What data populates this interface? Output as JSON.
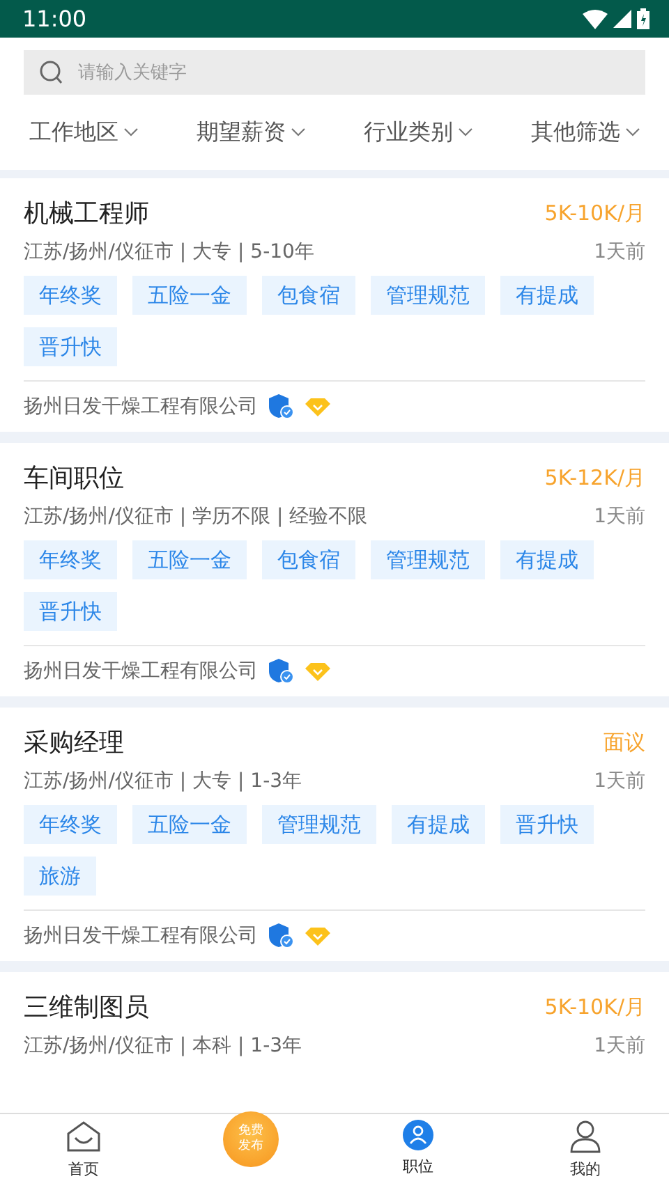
{
  "status_bar": {
    "time": "11:00"
  },
  "search": {
    "placeholder": "请输入关键字"
  },
  "filters": [
    "工作地区",
    "期望薪资",
    "行业类别",
    "其他筛选"
  ],
  "jobs": [
    {
      "title": "机械工程师",
      "salary": "5K-10K/月",
      "meta": "江苏/扬州/仪征市 | 大专 | 5-10年",
      "posted": "1天前",
      "tags": [
        "年终奖",
        "五险一金",
        "包食宿",
        "管理规范",
        "有提成",
        "晋升快"
      ],
      "company": "扬州日发干燥工程有限公司"
    },
    {
      "title": "车间职位",
      "salary": "5K-12K/月",
      "meta": "江苏/扬州/仪征市 | 学历不限 | 经验不限",
      "posted": "1天前",
      "tags": [
        "年终奖",
        "五险一金",
        "包食宿",
        "管理规范",
        "有提成",
        "晋升快"
      ],
      "company": "扬州日发干燥工程有限公司"
    },
    {
      "title": "采购经理",
      "salary": "面议",
      "meta": "江苏/扬州/仪征市 | 大专 | 1-3年",
      "posted": "1天前",
      "tags": [
        "年终奖",
        "五险一金",
        "管理规范",
        "有提成",
        "晋升快",
        "旅游"
      ],
      "company": "扬州日发干燥工程有限公司"
    },
    {
      "title": "三维制图员",
      "salary": "5K-10K/月",
      "meta": "江苏/扬州/仪征市 | 本科 | 1-3年",
      "posted": "1天前"
    }
  ],
  "bottom_nav": [
    {
      "kind": "home",
      "label": "首页",
      "selected": false
    },
    {
      "kind": "publish",
      "label": "免费发布",
      "selected": false
    },
    {
      "kind": "jobs",
      "label": "职位",
      "selected": true
    },
    {
      "kind": "profile",
      "label": "我的",
      "selected": false
    }
  ]
}
